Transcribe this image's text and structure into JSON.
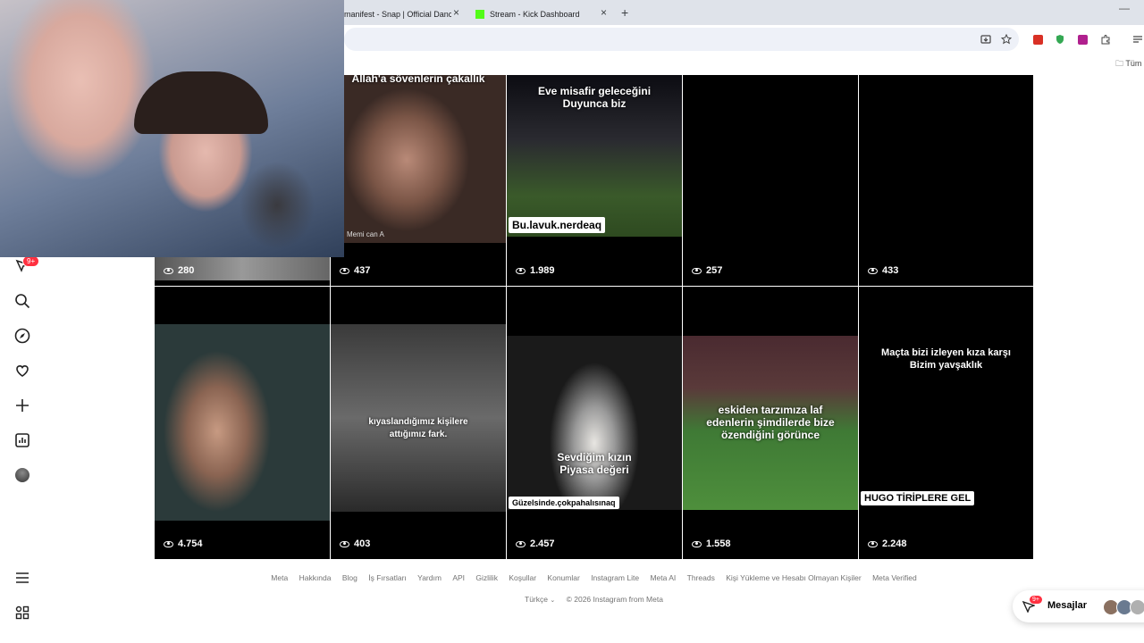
{
  "browser": {
    "tabs": [
      {
        "label": "manifest - Snap | Official Dance",
        "close": "×"
      },
      {
        "label": "Stream - Kick Dashboard",
        "close": "×"
      }
    ],
    "new_tab": "+",
    "window_minimize": "—",
    "bookmark_folder": "Tüm"
  },
  "sidebar": {
    "notification_badge": "9+"
  },
  "grid": {
    "row1": [
      {
        "views": "280"
      },
      {
        "views": "437",
        "caption": "Allah'a sövenlerin çakallık",
        "watermark": "Memi can A"
      },
      {
        "views": "1.989",
        "caption": "Eve misafir geleceğini\nDuyunca biz",
        "tag": "Bu.lavuk.nerdeaq"
      },
      {
        "views": "257"
      },
      {
        "views": "433"
      }
    ],
    "row2": [
      {
        "views": "4.754"
      },
      {
        "views": "403",
        "caption": "kıyaslandığımız kişilere\nattığımız fark."
      },
      {
        "views": "2.457",
        "caption": "Sevdiğim kızın\nPiyasa değeri",
        "tag": "Güzelsinde.çokpahalısınaq"
      },
      {
        "views": "1.558",
        "caption": "eskiden tarzımıza laf\nedenlerin şimdilerde bize\nözendiğini görünce"
      },
      {
        "views": "2.248",
        "caption": "Maçta bizi izleyen kıza karşı\nBizim yavşaklık",
        "tag": "HUGO TİRİPLERE GEL"
      }
    ]
  },
  "footer": {
    "links": [
      "Meta",
      "Hakkında",
      "Blog",
      "İş Fırsatları",
      "Yardım",
      "API",
      "Gizlilik",
      "Koşullar",
      "Konumlar",
      "Instagram Lite",
      "Meta AI",
      "Threads",
      "Kişi Yükleme ve Hesabı Olmayan Kişiler",
      "Meta Verified"
    ],
    "language": "Türkçe",
    "copyright": "© 2026 Instagram from Meta"
  },
  "messages": {
    "label": "Mesajlar",
    "badge": "9+"
  },
  "colors": {
    "badge_red": "#ff3040",
    "tabstrip": "#dfe3ea",
    "kick_green": "#53fc18"
  }
}
